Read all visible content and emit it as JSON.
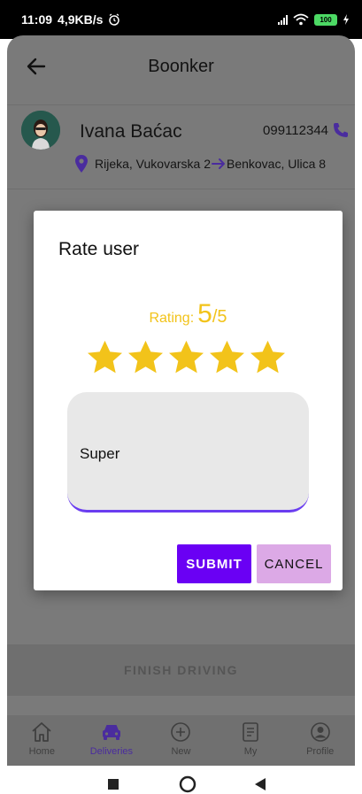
{
  "status_bar": {
    "time": "11:09",
    "speed": "4,9KB/s",
    "battery": "100"
  },
  "appbar": {
    "title": "Boonker"
  },
  "contact": {
    "name": "Ivana Baćac",
    "phone": "099112344",
    "from": "Rijeka, Vukovarska 2",
    "to": "Benkovac, Ulica 8"
  },
  "dialog": {
    "title": "Rate user",
    "rating_label": "Rating:",
    "rating_value": "5",
    "rating_max": "/5",
    "rating": 5,
    "stars_total": 5,
    "comment": "Super",
    "submit_label": "SUBMIT",
    "cancel_label": "CANCEL"
  },
  "finish_label": "FINISH DRIVING",
  "nav": {
    "items": [
      {
        "label": "Home",
        "icon": "home-icon"
      },
      {
        "label": "Deliveries",
        "icon": "car-icon"
      },
      {
        "label": "New",
        "icon": "add-circle-icon"
      },
      {
        "label": "My",
        "icon": "document-icon"
      },
      {
        "label": "Profile",
        "icon": "profile-icon"
      }
    ],
    "active": "Deliveries"
  },
  "colors": {
    "accent": "#6a00f4",
    "star": "#f2c31a",
    "cancel": "#dca9e6"
  }
}
